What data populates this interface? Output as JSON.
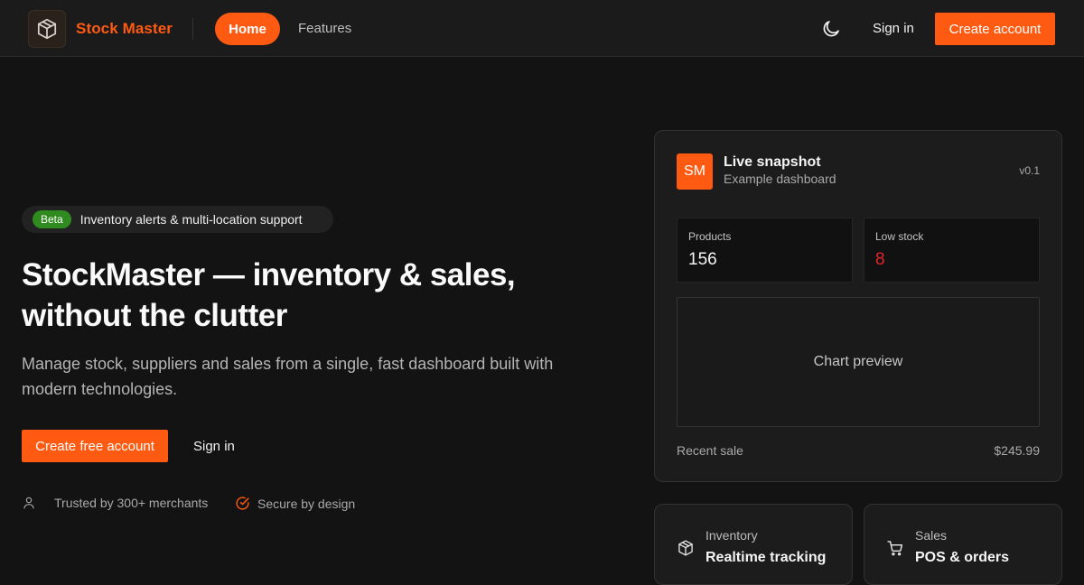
{
  "header": {
    "brand": "Stock Master",
    "nav": {
      "home": "Home",
      "features": "Features"
    },
    "sign_in": "Sign in",
    "create_account": "Create account",
    "icons": {
      "logo": "package-icon",
      "theme": "moon-icon"
    },
    "accent_color": "#ff5a12"
  },
  "hero": {
    "badge": "Beta",
    "badge_text": "Inventory alerts & multi-location support",
    "badge_color": "#2f8a1f",
    "title": "StockMaster — inventory & sales, without the clutter",
    "subtitle": "Manage stock, suppliers and sales from a single, fast dashboard built with modern technologies.",
    "cta_primary": "Create free account",
    "cta_secondary": "Sign in",
    "trust": [
      {
        "icon": "user-icon",
        "text": "Trusted by 300+ merchants"
      },
      {
        "icon": "check-circle-icon",
        "text": "Secure by design"
      }
    ]
  },
  "snapshot": {
    "avatar": "SM",
    "title": "Live snapshot",
    "subtitle": "Example dashboard",
    "version": "v0.1",
    "stats": [
      {
        "label": "Products",
        "value": "156"
      },
      {
        "label": "Low stock",
        "value": "8"
      }
    ],
    "chart_placeholder": "Chart preview",
    "recent_label": "Recent sale",
    "recent_value": "$245.99"
  },
  "features": [
    {
      "icon": "package-icon",
      "label": "Inventory",
      "title": "Realtime tracking"
    },
    {
      "icon": "cart-icon",
      "label": "Sales",
      "title": "POS & orders"
    }
  ]
}
